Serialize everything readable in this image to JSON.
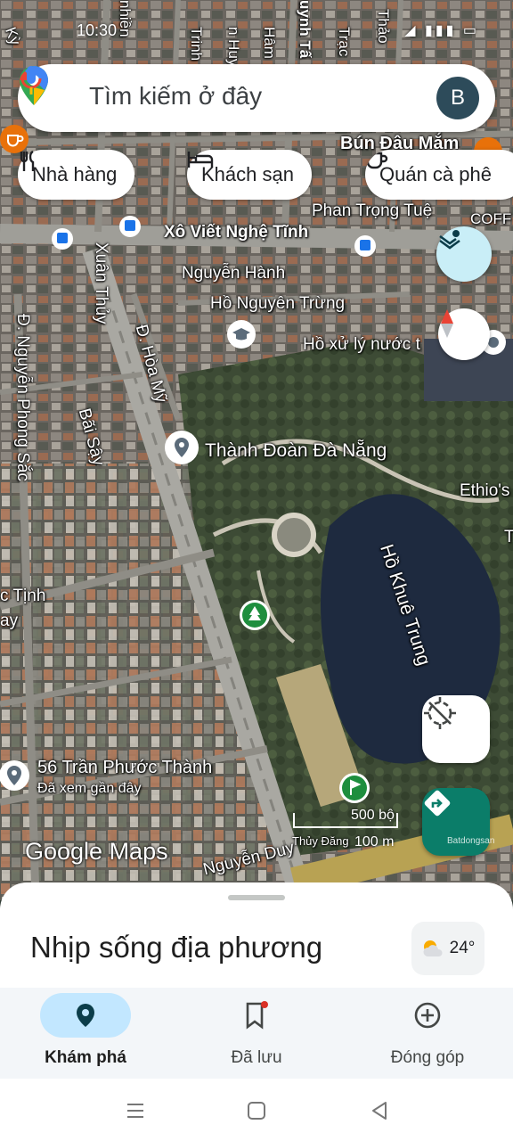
{
  "status_bar": {
    "time": "10:30",
    "icons": "◢ ▮▮▮ ▭"
  },
  "search": {
    "placeholder": "Tìm kiếm ở đây",
    "avatar_letter": "B"
  },
  "chips": [
    {
      "label": "Nhà hàng",
      "icon": "restaurant-icon"
    },
    {
      "label": "Khách sạn",
      "icon": "hotel-icon"
    },
    {
      "label": "Quán cà phê",
      "icon": "coffee-icon"
    }
  ],
  "map": {
    "streets": {
      "xo_viet_nghe_tinh": "Xô Viết Nghệ Tĩnh",
      "nguyen_hanh": "Nguyễn Hành",
      "ho_nguyen_trung": "Hồ Nguyên Trừng",
      "phan_trong_tue": "Phan Trọng Tuệ",
      "xuan_thuy": "Xuân Thủy",
      "hoa_my": "Đ. Hòa Mỹ",
      "nguyen_phong_sac": "Đ. Nguyễn Phong Sắc",
      "bai_say": "Bãi Sậy",
      "trung_tinh": "c Tịnh",
      "ay": "ay",
      "nguyen_duy": "Nguyễn Duy",
      "thuy_dang": "Thủy Đăng",
      "top_1": "Trinh",
      "top_2": "n Huy",
      "top_3": "Hâm",
      "top_4": "uynh Tấ",
      "top_5": "Trạc",
      "top_6": "Thảo",
      "top_7": "nhiền",
      "top_8": "Kỳ"
    },
    "pois": {
      "bun_dau": "Bún Đậu Mắm",
      "coffee": "COFF",
      "ho_xu_ly": "Hồ xử lý nước t",
      "thanh_doan": "Thành Đoàn Đà Nẵng",
      "ethio": "Ethio's",
      "lake": "Hồ Khuê Trung",
      "saved_place": "56 Trần Phước Thành",
      "saved_sub": "Đã xem gần đây",
      "t_letter": "T"
    },
    "scale": {
      "imperial": "500 bộ",
      "metric": "100 m"
    },
    "logo": "Google Maps",
    "watermark": "Batdongsan"
  },
  "sheet": {
    "title": "Nhịp sống địa phương",
    "temperature": "24°"
  },
  "nav": [
    {
      "label": "Khám phá",
      "icon": "explore-pin-icon",
      "active": true
    },
    {
      "label": "Đã lưu",
      "icon": "saved-bookmark-icon",
      "active": false
    },
    {
      "label": "Đóng góp",
      "icon": "contribute-plus-icon",
      "active": false
    }
  ],
  "colors": {
    "accent_teal": "#0b7d69",
    "nav_active": "#c2e7ff",
    "lake": "#1e2a3f"
  }
}
